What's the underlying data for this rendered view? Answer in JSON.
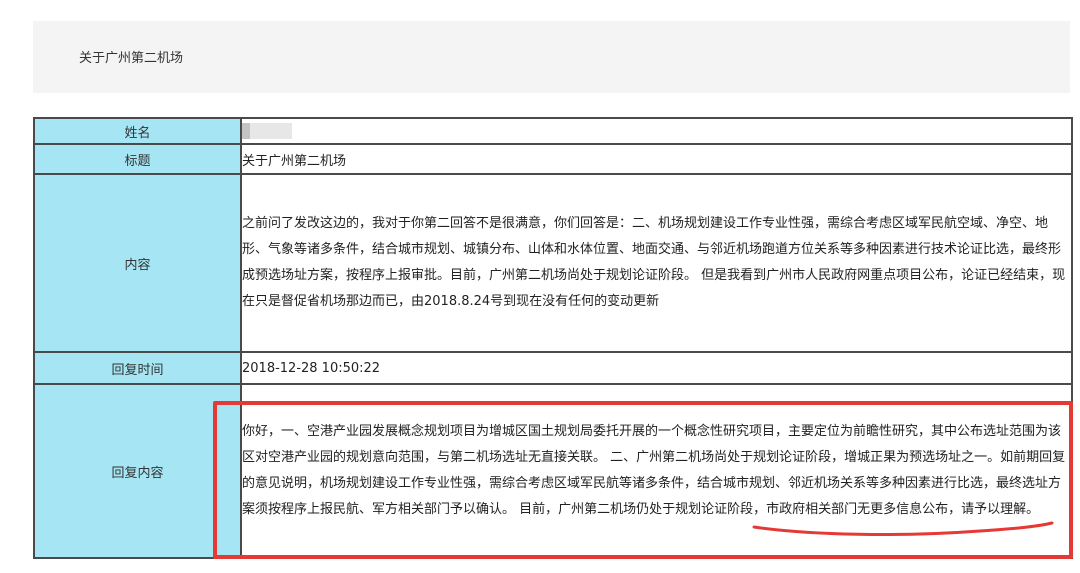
{
  "header": {
    "title": "关于广州第二机场"
  },
  "rows": {
    "name": {
      "label": "姓名",
      "value_redacted": true
    },
    "title": {
      "label": "标题",
      "value": "关于广州第二机场"
    },
    "content": {
      "label": "内容",
      "value": "之前问了发改这边的，我对于你第二回答不是很满意，你们回答是：二、机场规划建设工作专业性强，需综合考虑区域军民航空域、净空、地形、气象等诸多条件，结合城市规划、城镇分布、山体和水体位置、地面交通、与邻近机场跑道方位关系等多种因素进行技术论证比选，最终形成预选场址方案，按程序上报审批。目前，广州第二机场尚处于规划论证阶段。 但是我看到广州市人民政府网重点项目公布，论证已经结束，现在只是督促省机场那边而已，由2018.8.24号到现在没有任何的变动更新"
    },
    "reply_time": {
      "label": "回复时间",
      "value": "2018-12-28 10:50:22"
    },
    "reply_content": {
      "label": "回复内容",
      "value": "你好，一、空港产业园发展概念规划项目为增城区国土规划局委托开展的一个概念性研究项目，主要定位为前瞻性研究，其中公布选址范围为该区对空港产业园的规划意向范围，与第二机场选址无直接关联。 二、广州第二机场尚处于规划论证阶段，增城正果为预选场址之一。如前期回复的意见说明，机场规划建设工作专业性强，需综合考虑区域军民航等诸多条件，结合城市规划、邻近机场关系等多种因素进行比选，最终选址方案须按程序上报民航、军方相关部门予以确认。 目前，广州第二机场仍处于规划论证阶段，市政府相关部门无更多信息公布，请予以理解。"
    }
  },
  "colors": {
    "label_bg": "#a6e6f4",
    "highlight": "#e53935"
  }
}
